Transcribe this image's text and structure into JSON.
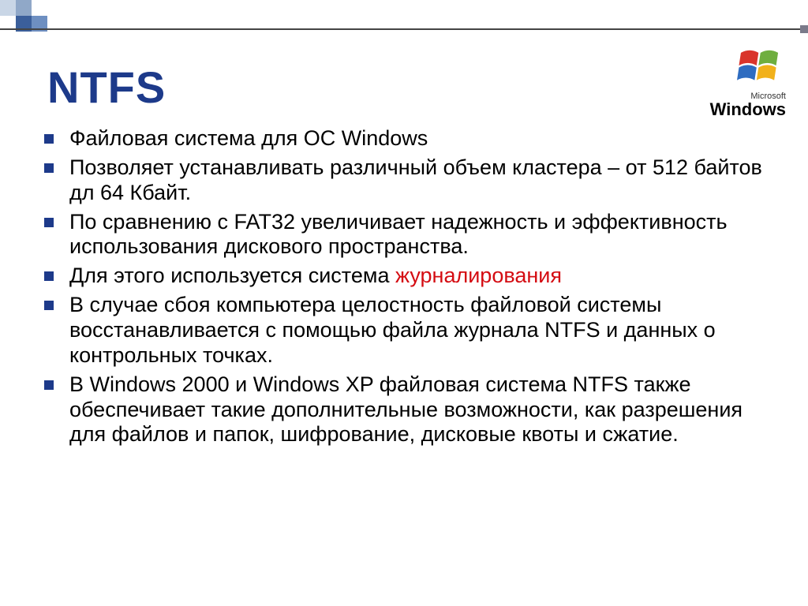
{
  "title": "NTFS",
  "logo": {
    "sub": "Microsoft",
    "main": "Windows"
  },
  "bullets": {
    "b0": "Файловая система для ОС Windows",
    "b1": "Позволяет устанавливать различный объем кластера – от 512 байтов дл 64 Кбайт.",
    "b2": "По сравнению с FAT32 увеличивает надежность и эффективность использования дискового пространства.",
    "b3_pre": "Для этого используется система ",
    "b3_hl": "журналирования",
    "b4": "В случае сбоя компьютера целостность файловой системы восстанавливается с помощью файла журнала NTFS и данных о контрольных точках.",
    "b5": "В Windows 2000 и Windows XP файловая система NTFS также обеспечивает такие дополнительные возможности, как разрешения для файлов и папок, шифрование, дисковые квоты и сжатие."
  }
}
